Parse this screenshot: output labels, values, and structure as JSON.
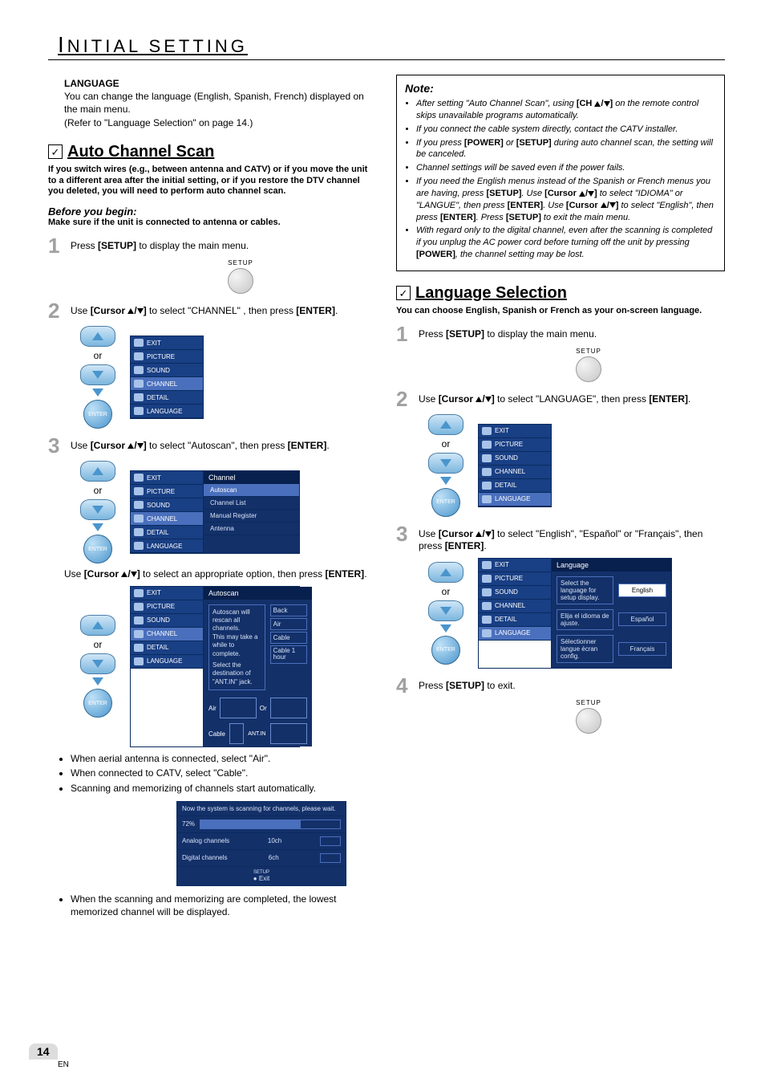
{
  "page": {
    "title_prefix": "I",
    "title_rest": "NITIAL SETTING",
    "number": "14",
    "lang_code": "EN"
  },
  "language_para": {
    "label": "LANGUAGE",
    "text": "You can change the language (English, Spanish, French) displayed on the main menu.",
    "refer": "(Refer to \"Language Selection\" on page 14.)"
  },
  "autoscan": {
    "heading": "Auto Channel Scan",
    "intro": "If you switch wires (e.g., between antenna and CATV) or if you move the unit to a different area after the initial setting, or if you restore the DTV channel you deleted, you will need to perform auto channel scan.",
    "before_label": "Before you begin:",
    "before_text": "Make sure if the unit is connected to antenna or cables.",
    "steps": {
      "s1": "Press [SETUP] to display the main menu.",
      "s2": "Use [Cursor ▲/▼] to select \"CHANNEL\" , then press [ENTER].",
      "s3": "Use [Cursor ▲/▼] to select \"Autoscan\", then press [ENTER].",
      "s3b": "Use [Cursor ▲/▼] to select an appropriate option, then press [ENTER]."
    },
    "bullets": {
      "a": "When aerial antenna is connected, select \"Air\".",
      "b": "When connected to CATV, select \"Cable\".",
      "c": "Scanning and memorizing of channels start automatically.",
      "d": "When the scanning and memorizing are completed, the lowest memorized channel will be displayed."
    }
  },
  "menu_items": {
    "exit": "EXIT",
    "picture": "PICTURE",
    "sound": "SOUND",
    "channel": "CHANNEL",
    "detail": "DETAIL",
    "language": "LANGUAGE"
  },
  "channel_menu": {
    "header": "Channel",
    "items": [
      "Autoscan",
      "Channel List",
      "Manual Register",
      "Antenna"
    ]
  },
  "autoscan_menu": {
    "header": "Autoscan",
    "msg1": "Autoscan will rescan all channels.",
    "msg2": "This may take a while to complete.",
    "msg3": "Select the destination of \"ANT.IN\" jack.",
    "right": [
      "Back",
      "Air",
      "Cable",
      "Cable 1 hour"
    ],
    "air": "Air",
    "cable": "Cable",
    "or": "Or",
    "antin": "ANT.IN"
  },
  "scanbox": {
    "msg": "Now the system is scanning for channels, please wait.",
    "pct": "72%",
    "analog": "Analog channels",
    "analog_n": "10ch",
    "digital": "Digital channels",
    "digital_n": "6ch",
    "exit": "Exit",
    "setup": "SETUP"
  },
  "note": {
    "title": "Note:",
    "items": [
      "After setting \"Auto Channel Scan\", using [CH ▲/▼] on the remote control skips unavailable programs automatically.",
      "If you connect the cable system directly, contact the CATV installer.",
      "If you press [POWER] or [SETUP] during auto channel scan, the setting will be canceled.",
      "Channel settings will be saved even if the power fails.",
      "If you need the English menus instead of the Spanish or French menus you are having, press [SETUP]. Use [Cursor ▲/▼] to select \"IDIOMA\" or \"LANGUE\", then press [ENTER]. Use [Cursor ▲/▼] to select \"English\", then press [ENTER]. Press [SETUP] to exit the main menu.",
      "With regard only to the digital channel, even after the scanning is completed if you unplug the AC power cord before turning off the unit by pressing [POWER], the channel setting may be lost."
    ]
  },
  "langsel": {
    "heading": "Language Selection",
    "intro": "You can choose English, Spanish or French as your on-screen language.",
    "steps": {
      "s1": "Press [SETUP] to display the main menu.",
      "s2": "Use [Cursor ▲/▼] to select \"LANGUAGE\", then press [ENTER].",
      "s3": "Use [Cursor ▲/▼] to select \"English\", \"Español\" or \"Français\", then press [ENTER].",
      "s4": "Press [SETUP] to exit."
    }
  },
  "lang_menu": {
    "header": "Language",
    "rows": [
      {
        "txt": "Select the language for setup display.",
        "opt": "English",
        "sel": true
      },
      {
        "txt": "Elija el idioma de ajuste.",
        "opt": "Español",
        "sel": false
      },
      {
        "txt": "Sélectionner langue écran config.",
        "opt": "Français",
        "sel": false
      }
    ]
  },
  "common": {
    "or": "or",
    "setup": "SETUP",
    "enter": "ENTER"
  }
}
